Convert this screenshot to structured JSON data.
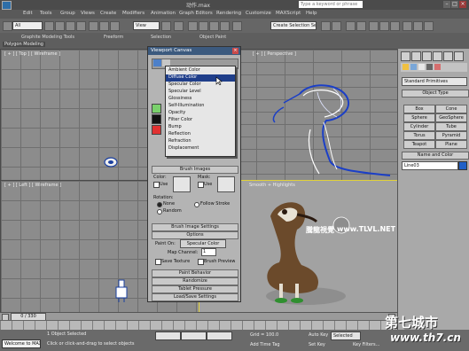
{
  "titlebar": {
    "title": "动作.max",
    "search_placeholder": "Type a keyword or phrase"
  },
  "menu": [
    "Edit",
    "Tools",
    "Group",
    "Views",
    "Create",
    "Modifiers",
    "Animation",
    "Graph Editors",
    "Rendering",
    "Customize",
    "MAXScript",
    "Help"
  ],
  "toolbar": {
    "filter_value": "All",
    "view_value": "View",
    "selection_set_placeholder": "Create Selection Set"
  },
  "ribbon": {
    "tabs": [
      "Graphite Modeling Tools",
      "Freeform",
      "Selection",
      "Object Paint"
    ],
    "sub_label": "Polygon Modeling"
  },
  "viewports": {
    "top_left": "[ + ] [ Top ] [ Wireframe ]",
    "top_right": "[ + ] [ Perspective ]",
    "bottom_left": "[ + ] [ Left ] [ Wireframe ]",
    "bottom_right": "Smooth + Highlights"
  },
  "dialog": {
    "title": "Viewport Canvas",
    "rollouts": {
      "brush_images": "Brush Images",
      "brush_image_settings": "Brush Image Settings",
      "options": "Options",
      "paint_behavior": "Paint Behavior",
      "randomize": "Randomize",
      "tablet_pressure": "Tablet Pressure",
      "load_save": "Load/Save Settings"
    },
    "color_label": "Color:",
    "mask_label": "Mask:",
    "use_label": "Use",
    "rotation_label": "Rotation:",
    "rotation_none": "None",
    "rotation_follow": "Follow Stroke",
    "rotation_random": "Random",
    "paint_on_label": "Paint On:",
    "paint_on_value": "Specular Color",
    "map_channel_label": "Map Channel:",
    "map_channel_value": "1",
    "save_texture": "Save Texture",
    "brush_preview": "Brush Preview"
  },
  "dropdown": {
    "items": [
      "Ambient Color",
      "Diffuse Color",
      "Specular Color",
      "Specular Level",
      "Glossiness",
      "Self-Illumination",
      "Opacity",
      "Filter Color",
      "Bump",
      "Reflection",
      "Refraction",
      "Displacement"
    ],
    "selected_index": 1
  },
  "cmd_panel": {
    "category": "Standard Primitives",
    "object_type_header": "Object Type",
    "buttons": [
      "Box",
      "Cone",
      "Sphere",
      "GeoSphere",
      "Cylinder",
      "Tube",
      "Torus",
      "Pyramid",
      "Teapot",
      "Plane"
    ],
    "name_color_header": "Name and Color",
    "object_name": "Line03",
    "object_color": "#1f5fc7"
  },
  "timeline": {
    "frame_display": "0 / 330"
  },
  "status": {
    "maxscript_label": "Welcome to MAX",
    "selection_status": "1 Object Selected",
    "prompt": "Click or click-and-drag to select objects",
    "grid": "Grid = 100.0",
    "add_time_tag": "Add Time Tag",
    "auto_key": "Auto Key",
    "selected_dropdown": "Selected",
    "set_key": "Set Key",
    "key_filters": "Key Filters..."
  },
  "watermarks": {
    "site_cn": "第七城市",
    "site_url": "www.th7.cn",
    "tlvl": "www.TLVL.NET",
    "tlvl_cn": "騰龍視覺"
  },
  "colors": {
    "dialog_title": "#3c5a7e",
    "menu_highlight": "#1f3e8a",
    "selection_border": "#e1d23a"
  }
}
